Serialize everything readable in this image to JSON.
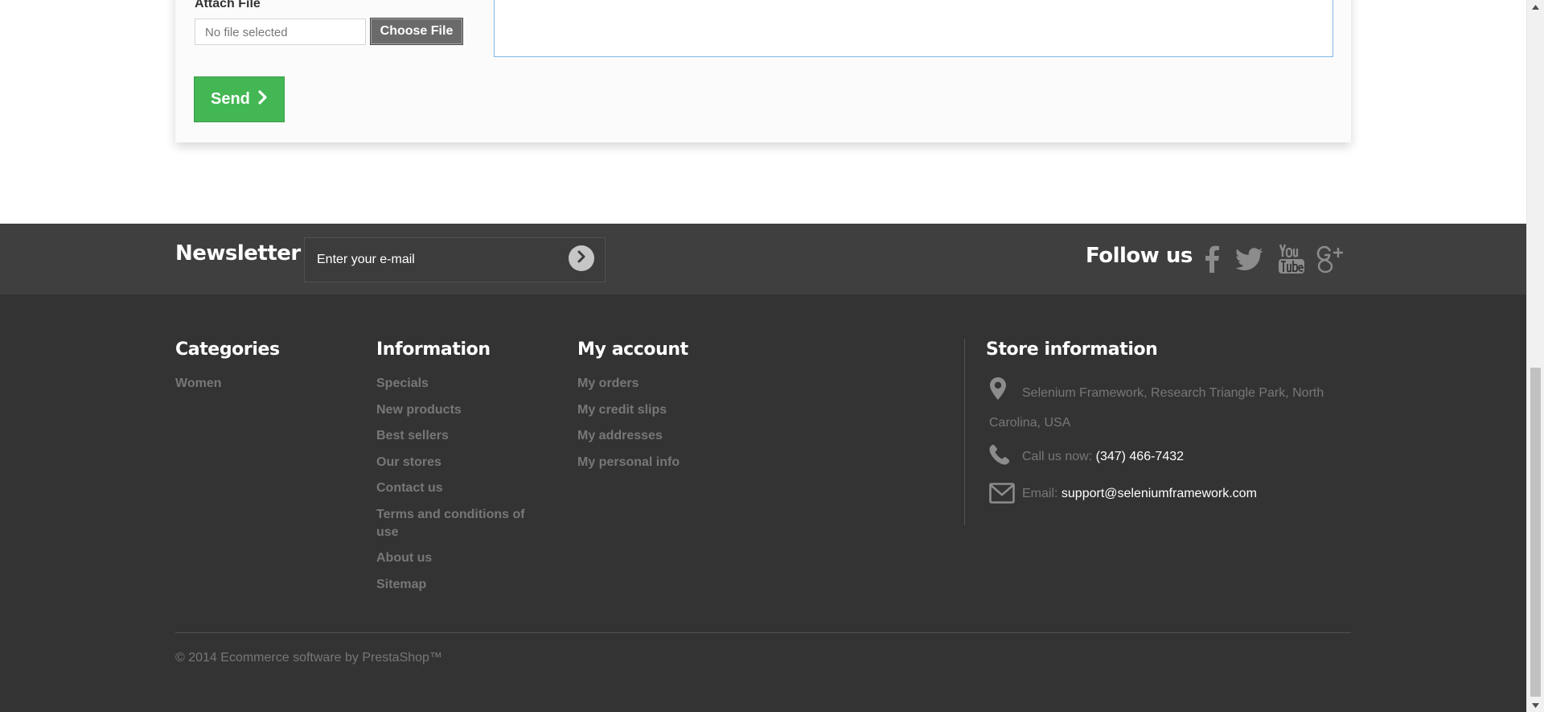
{
  "contact_form": {
    "attach_label": "Attach File",
    "file_status": "No file selected",
    "choose_file_label": "Choose File",
    "send_label": "Send"
  },
  "newsletter": {
    "title": "Newsletter",
    "placeholder": "Enter your e-mail"
  },
  "follow": {
    "title": "Follow us",
    "networks": [
      "facebook-icon",
      "twitter-icon",
      "youtube-icon",
      "google-plus-icon"
    ]
  },
  "footer": {
    "categories": {
      "title": "Categories",
      "items": [
        "Women"
      ]
    },
    "information": {
      "title": "Information",
      "items": [
        "Specials",
        "New products",
        "Best sellers",
        "Our stores",
        "Contact us",
        "Terms and conditions of use",
        "About us",
        "Sitemap"
      ]
    },
    "my_account": {
      "title": "My account",
      "items": [
        "My orders",
        "My credit slips",
        "My addresses",
        "My personal info"
      ]
    },
    "store": {
      "title": "Store information",
      "address": "Selenium Framework, Research Triangle Park, North Carolina, USA",
      "phone_label": "Call us now:",
      "phone": "(347) 466-7432",
      "email_label": "Email:",
      "email": "support@seleniumframework.com"
    },
    "copyright": "© 2014 Ecommerce software by PrestaShop™"
  },
  "colors": {
    "send_green": "#43b754",
    "footer_dark": "#333333",
    "footer_band": "#3f3f3f",
    "link_gray": "#777777"
  }
}
